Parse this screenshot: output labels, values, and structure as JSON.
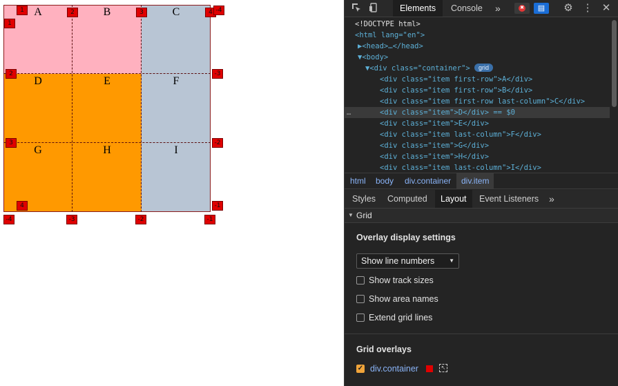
{
  "preview": {
    "cells": [
      {
        "letter": "A",
        "color": "#ffb1bf"
      },
      {
        "letter": "B",
        "color": "#ffb1bf"
      },
      {
        "letter": "C",
        "color": "#b8c5d4"
      },
      {
        "letter": "D",
        "color": "#ff9900"
      },
      {
        "letter": "E",
        "color": "#ff9900"
      },
      {
        "letter": "F",
        "color": "#b8c5d4"
      },
      {
        "letter": "G",
        "color": "#ff9900"
      },
      {
        "letter": "H",
        "color": "#ff9900"
      },
      {
        "letter": "I",
        "color": "#b8c5d4"
      }
    ],
    "line_numbers": {
      "top": [
        "1",
        "2",
        "3",
        "4"
      ],
      "top_neg": "-4",
      "left": [
        "1",
        "2",
        "3"
      ],
      "right": [
        "-3",
        "-2",
        "-1"
      ],
      "bottom": [
        "-4",
        "-3",
        "-2",
        "-1"
      ],
      "bottom_pos": "4"
    }
  },
  "devtools": {
    "tabs": [
      "Elements",
      "Console"
    ],
    "more_tabs": "»",
    "dom_lines": [
      {
        "indent": 0,
        "html": "<!DOCTYPE html>"
      },
      {
        "indent": 0,
        "html": "<html lang=\"en\">"
      },
      {
        "indent": 1,
        "html": "▶<head>…</head>"
      },
      {
        "indent": 1,
        "html": "▼<body>"
      },
      {
        "indent": 2,
        "html": "▼<div class=\"container\">"
      },
      {
        "indent": 3,
        "html": "<div class=\"item first-row\">A</div>"
      },
      {
        "indent": 3,
        "html": "<div class=\"item first-row\">B</div>"
      },
      {
        "indent": 3,
        "html": "<div class=\"item first-row last-column\">C</div>"
      },
      {
        "indent": 3,
        "html": "<div class=\"item\">D</div> == $0"
      },
      {
        "indent": 3,
        "html": "<div class=\"item\">E</div>"
      },
      {
        "indent": 3,
        "html": "<div class=\"item last-column\">F</div>"
      },
      {
        "indent": 3,
        "html": "<div class=\"item\">G</div>"
      },
      {
        "indent": 3,
        "html": "<div class=\"item\">H</div>"
      },
      {
        "indent": 3,
        "html": "<div class=\"item last-column\">I</div>"
      }
    ],
    "grid_badge": "grid",
    "breadcrumbs": [
      "html",
      "body",
      "div.container",
      "div.item"
    ],
    "subtabs": [
      "Styles",
      "Computed",
      "Layout",
      "Event Listeners"
    ],
    "section": "Grid",
    "overlay_title": "Overlay display settings",
    "select_value": "Show line numbers",
    "checkboxes": [
      "Show track sizes",
      "Show area names",
      "Extend grid lines"
    ],
    "grid_overlays_title": "Grid overlays",
    "overlay_item": {
      "name": "div.container",
      "color": "#e00000",
      "checked": true
    }
  }
}
